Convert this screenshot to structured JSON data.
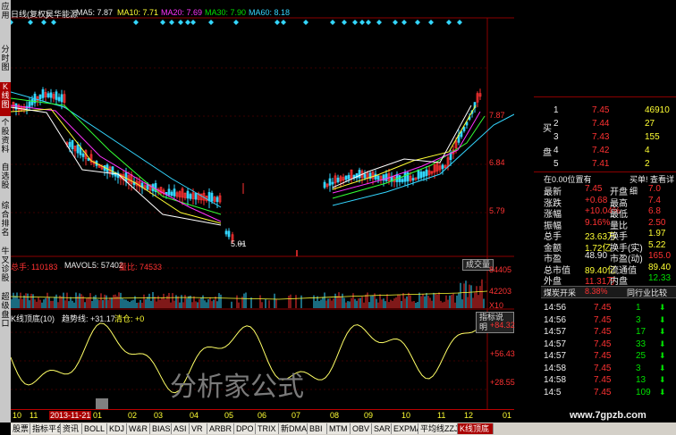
{
  "sidebar": {
    "tabs": [
      {
        "label": "应用",
        "active": false
      },
      {
        "label": "分时图",
        "active": false
      },
      {
        "label": "K线图",
        "active": true
      },
      {
        "label": "个股资料",
        "active": false
      },
      {
        "label": "自选股",
        "active": false
      },
      {
        "label": "综合排名",
        "active": false
      },
      {
        "label": "牛叉诊股",
        "active": false
      },
      {
        "label": "超级盘口",
        "active": false
      }
    ]
  },
  "header": {
    "period": "日线(复权)",
    "stock_name": "昊华能源",
    "ma5": "MA5: 7.87",
    "ma10": "MA10: 7.71",
    "ma20": "MA20: 7.69",
    "ma30": "MA30: 7.90",
    "ma60": "MA60: 8.18"
  },
  "price_axis": [
    "7.87",
    "6.84",
    "5.79"
  ],
  "price_low_label": "5.01",
  "volume": {
    "total": "总手: 110183",
    "mavol5": "MAVOL5: 57402",
    "liangbi": "量比: 74533",
    "button": "成交量",
    "axis": [
      "84405",
      "42203",
      "X10"
    ]
  },
  "indicator": {
    "title": "K线顶底(10)",
    "trend": "趋势线: +31.17",
    "qingcang": "清仓: +0",
    "button": "指标说明",
    "axis": [
      "+84.32",
      "+56.43",
      "+28.55"
    ],
    "watermark": "分析家公式"
  },
  "time_axis": {
    "labels": [
      "10",
      "11",
      "2013-11-21",
      "01",
      "02",
      "03",
      "04",
      "05",
      "06",
      "07",
      "08",
      "09",
      "10",
      "11",
      "12",
      "01"
    ]
  },
  "order_book": {
    "sell_label": "卖",
    "buy_label": "买",
    "pan_label": "盘",
    "rows": [
      {
        "level": "1",
        "price": "7.45",
        "vol": "46910"
      },
      {
        "level": "2",
        "price": "7.44",
        "vol": "27"
      },
      {
        "level": "3",
        "price": "7.43",
        "vol": "155"
      },
      {
        "level": "4",
        "price": "7.42",
        "vol": "4"
      },
      {
        "level": "5",
        "price": "7.41",
        "vol": "2"
      }
    ]
  },
  "quote": {
    "position_label": "在0.00位置有",
    "buy_one": "买单! 查看详细",
    "rows": [
      {
        "l1": "最新",
        "v1": "7.45",
        "l2": "开盘",
        "v2": "7.0"
      },
      {
        "l1": "涨跌",
        "v1": "+0.68",
        "l2": "最高",
        "v2": "7.4"
      },
      {
        "l1": "涨幅",
        "v1": "+10.04%",
        "l2": "最低",
        "v2": "6.8"
      },
      {
        "l1": "振幅",
        "v1": "9.16%",
        "l2": "量比",
        "v2": "2.50"
      },
      {
        "l1": "总手",
        "v1": "23.63万",
        "l2": "换手",
        "v2": "1.97"
      },
      {
        "l1": "金额",
        "v1": "1.72亿",
        "l2": "换手(实)",
        "v2": "5.22"
      },
      {
        "l1": "市盈",
        "v1": "48.90",
        "l2": "市盈(动)",
        "v2": "165.0"
      },
      {
        "l1": "总市值",
        "v1": "89.40亿",
        "l2": "流通值",
        "v2": "89.40"
      },
      {
        "l1": "外盘",
        "v1": "11.31万",
        "l2": "内盘",
        "v2": "12.33"
      }
    ],
    "sector": "煤炭开采",
    "sector_pct": "8.38%",
    "sector_compare": "同行业比较"
  },
  "trades": [
    {
      "time": "14:56",
      "price": "7.45",
      "vol": "1"
    },
    {
      "time": "14:56",
      "price": "7.45",
      "vol": "3"
    },
    {
      "time": "14:57",
      "price": "7.45",
      "vol": "17"
    },
    {
      "time": "14:57",
      "price": "7.45",
      "vol": "33"
    },
    {
      "time": "14:57",
      "price": "7.45",
      "vol": "25"
    },
    {
      "time": "14:58",
      "price": "7.45",
      "vol": "3"
    },
    {
      "time": "14:58",
      "price": "7.45",
      "vol": "13"
    },
    {
      "time": "14:5",
      "price": "7.45",
      "vol": "109"
    }
  ],
  "website": "www.7gpzb.com",
  "bottom_tabs": [
    {
      "label": "股票",
      "active": false
    },
    {
      "label": "指标平台",
      "active": false
    },
    {
      "label": "资讯",
      "active": false
    },
    {
      "label": "BOLL",
      "active": false
    },
    {
      "label": "KDJ",
      "active": false
    },
    {
      "label": "W&R",
      "active": false
    },
    {
      "label": "BIAS",
      "active": false
    },
    {
      "label": "ASI",
      "active": false
    },
    {
      "label": "VR",
      "active": false
    },
    {
      "label": "ARBR",
      "active": false
    },
    {
      "label": "DPO",
      "active": false
    },
    {
      "label": "TRIX",
      "active": false
    },
    {
      "label": "新DMA",
      "active": false
    },
    {
      "label": "BBI",
      "active": false
    },
    {
      "label": "MTM",
      "active": false
    },
    {
      "label": "OBV",
      "active": false
    },
    {
      "label": "SAR",
      "active": false
    },
    {
      "label": "EXPMA",
      "active": false
    },
    {
      "label": "平均线ZZJ",
      "active": false
    },
    {
      "label": "K线顶底",
      "active": true
    }
  ],
  "colors": {
    "up": "#ff3232",
    "down": "#33d6ff",
    "ma5": "#ffffff",
    "ma10": "#ffff33",
    "ma20": "#ff33ff",
    "ma30": "#33ff33",
    "ma60": "#33d6ff",
    "grid": "#8b0000"
  }
}
